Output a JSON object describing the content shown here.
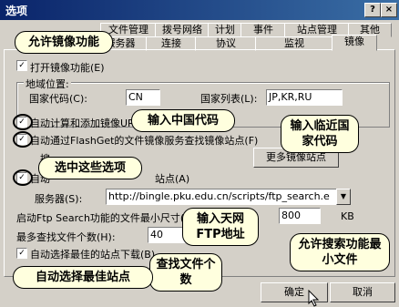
{
  "window": {
    "title": "选项"
  },
  "tabs_row1": [
    "文件管理",
    "拨号网络",
    "计划",
    "事件",
    "站点管理",
    "其他"
  ],
  "tabs_row2": [
    "代理服务器",
    "连接",
    "协议",
    "监视",
    "镜像"
  ],
  "options": {
    "enable_mirror": "打开镜像功能(E)",
    "region_label": "地域位置:",
    "country_code_label": "国家代码(C):",
    "country_code_value": "CN",
    "country_list_label": "国家列表(L):",
    "country_list_value": "JP,KR,RU",
    "auto_calc": "自动计算和添加镜像URL",
    "auto_search": "自动通过FlashGet的文件镜像服务查找镜像站点(F)",
    "search_label": "搜",
    "more_sites_btn": "更多镜像站点",
    "auto_label": "自动",
    "ftp_search_sites": "站点(A)",
    "server_label": "服务器(S):",
    "server_value": "http://bingle.pku.edu.cn/scripts/ftp_search.e",
    "min_size_label": "启动Ftp Search功能的文件最小尺寸(M)",
    "min_size_value": "800",
    "min_size_unit": "KB",
    "max_files_label": "最多查找文件个数(H):",
    "max_files_value": "40",
    "auto_best": "自动选择最佳的站点下载(B)"
  },
  "buttons": {
    "ok": "确定",
    "cancel": "取消"
  },
  "callouts": {
    "c1": "允许镜像功能",
    "c2": "输入中国代码",
    "c3": "输入临近国家代码",
    "c4": "选中这些选项",
    "c5": "输入天网FTP地址",
    "c6": "允许搜索功能最小文件",
    "c7": "查找文件个数",
    "c8": "自动选择最佳站点"
  }
}
